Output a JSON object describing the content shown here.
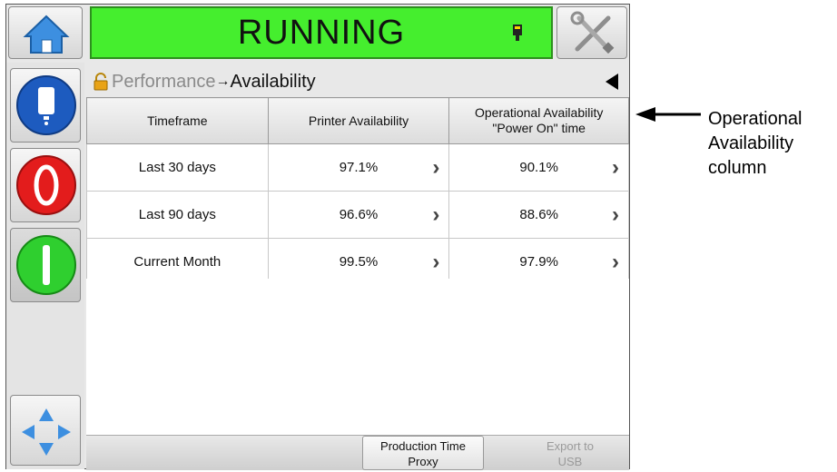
{
  "header": {
    "status": "RUNNING"
  },
  "breadcrumb": {
    "parent": "Performance",
    "separator": "→",
    "current": "Availability"
  },
  "table": {
    "headers": [
      "Timeframe",
      "Printer Availability",
      "Operational Availability\n\"Power On\" time"
    ],
    "rows": [
      {
        "timeframe": "Last 30 days",
        "printer": "97.1%",
        "operational": "90.1%"
      },
      {
        "timeframe": "Last 90 days",
        "printer": "96.6%",
        "operational": "88.6%"
      },
      {
        "timeframe": "Current Month",
        "printer": "99.5%",
        "operational": "97.9%"
      }
    ]
  },
  "footer": {
    "production_time_proxy": "Production Time\nProxy",
    "export_to_usb": "Export to\nUSB"
  },
  "annotation": {
    "label": "Operational\nAvailability\ncolumn"
  },
  "colors": {
    "status_bg": "#45ee2e",
    "stop_red": "#e31c1c",
    "start_green": "#2fcf2f",
    "info_blue": "#1d5bbf"
  }
}
